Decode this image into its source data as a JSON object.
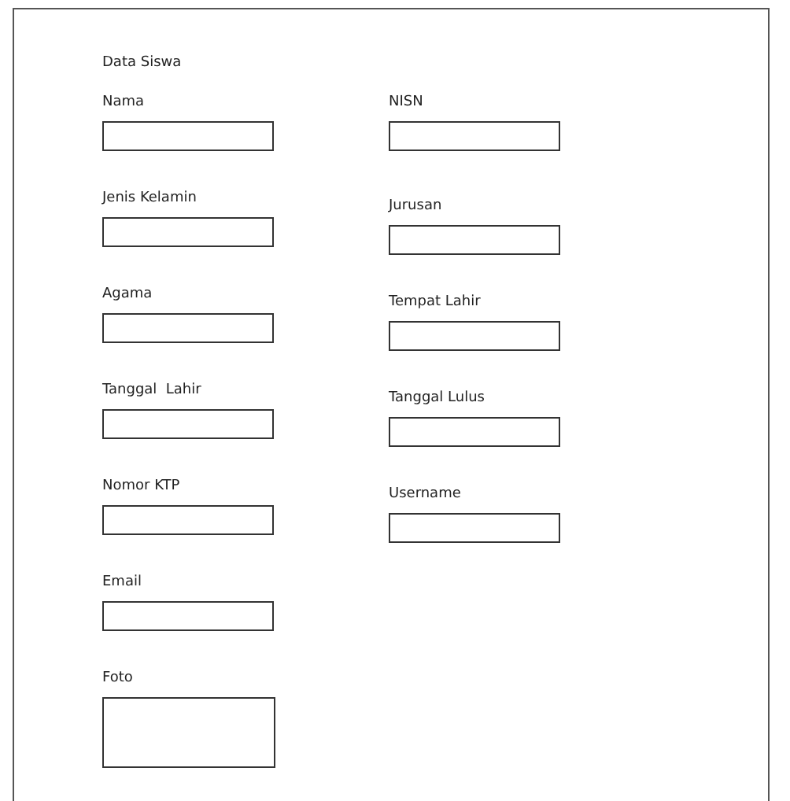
{
  "title": "Data Siswa",
  "left_fields": [
    {
      "label": "Nama",
      "kind": "text"
    },
    {
      "label": "Jenis Kelamin",
      "kind": "text"
    },
    {
      "label": "Agama",
      "kind": "text"
    },
    {
      "label": "Tanggal  Lahir",
      "kind": "text"
    },
    {
      "label": "Nomor KTP",
      "kind": "text"
    },
    {
      "label": "Email",
      "kind": "text"
    },
    {
      "label": "Foto",
      "kind": "photo"
    }
  ],
  "right_fields": [
    {
      "label": "NISN",
      "kind": "text"
    },
    {
      "label": "Jurusan",
      "kind": "text"
    },
    {
      "label": "Tempat Lahir",
      "kind": "text"
    },
    {
      "label": "Tanggal Lulus",
      "kind": "text"
    },
    {
      "label": "Username",
      "kind": "text"
    }
  ]
}
